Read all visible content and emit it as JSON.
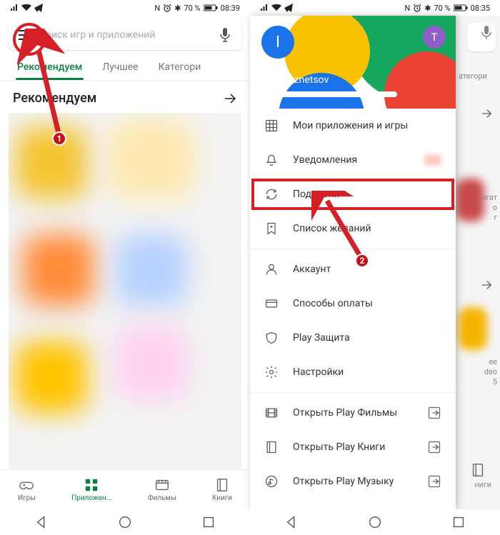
{
  "left": {
    "status": {
      "nfc": "N",
      "bt": "✱",
      "batt": "70 %",
      "time": "08:39"
    },
    "search": {
      "placeholder": "Поиск игр и приложений"
    },
    "tabs": {
      "recommended": "Рекомендуем",
      "best": "Лучшее",
      "categories": "Категори"
    },
    "section_title": "Рекомендуем",
    "bottom": {
      "games": "Игры",
      "apps": "Приложен...",
      "movies": "Фильмы",
      "books": "Книги"
    },
    "annotation": {
      "badge1": "1"
    }
  },
  "right": {
    "status": {
      "nfc": "N",
      "bt": "✱",
      "batt": "70 %",
      "time": "08:35"
    },
    "tabs_peek": "атегори",
    "header": {
      "avatar_letter": "I",
      "secondary_letter": "T",
      "name": "Ivan Kuznetsov"
    },
    "menu": {
      "my_apps": "Мои приложения и игры",
      "notifications": "Уведомления",
      "subscriptions": "Подписки",
      "wishlist": "Список желаний",
      "account": "Аккаунт",
      "payment": "Способы оплаты",
      "protect": "Play Защита",
      "settings": "Настройки",
      "open_movies": "Открыть Play Фильмы",
      "open_books": "Открыть Play Книги",
      "open_music": "Открыть Play Музыку"
    },
    "peek": {
      "card1_line1": "игат",
      "card1_line2": "о",
      "card1_line3": "г",
      "card2_line1": "ее",
      "card2_line2": "deo",
      "card2_line3": "5",
      "books_label": "ниги"
    },
    "annotation": {
      "badge2": "2"
    }
  }
}
